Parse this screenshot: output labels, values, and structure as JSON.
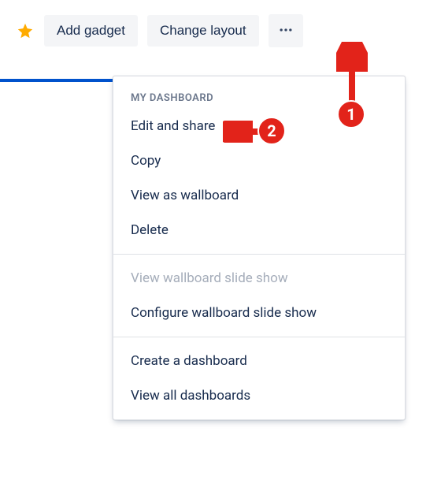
{
  "toolbar": {
    "add_gadget_label": "Add gadget",
    "change_layout_label": "Change layout"
  },
  "dropdown": {
    "header": "MY DASHBOARD",
    "section1": [
      "Edit and share",
      "Copy",
      "View as wallboard",
      "Delete"
    ],
    "section2": [
      {
        "label": "View wallboard slide show",
        "disabled": true
      },
      {
        "label": "Configure wallboard slide show",
        "disabled": false
      }
    ],
    "section3": [
      "Create a dashboard",
      "View all dashboards"
    ]
  },
  "annotations": {
    "badge1": "1",
    "badge2": "2"
  }
}
